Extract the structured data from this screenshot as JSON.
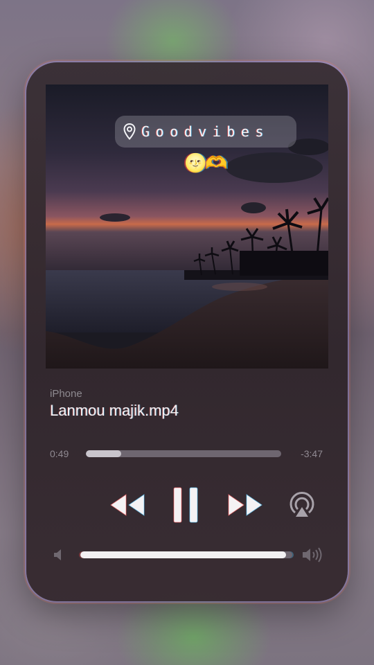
{
  "caption": {
    "text": "Goodvibes",
    "icon": "map-pin-icon",
    "emoji": "🌝🫶"
  },
  "player": {
    "source": "iPhone",
    "title": "Lanmou majik.mp4",
    "elapsed": "0:49",
    "remaining": "-3:47",
    "progress_fraction": 0.18,
    "volume_fraction": 0.97,
    "state": "playing"
  },
  "controls": {
    "rewind_icon": "rewind-icon",
    "pause_icon": "pause-icon",
    "forward_icon": "fast-forward-icon",
    "airplay_icon": "airplay-icon",
    "volume_low_icon": "speaker-low-icon",
    "volume_high_icon": "speaker-high-icon"
  },
  "colors": {
    "accent": "#f2f0f2",
    "track": "#6e6670"
  }
}
